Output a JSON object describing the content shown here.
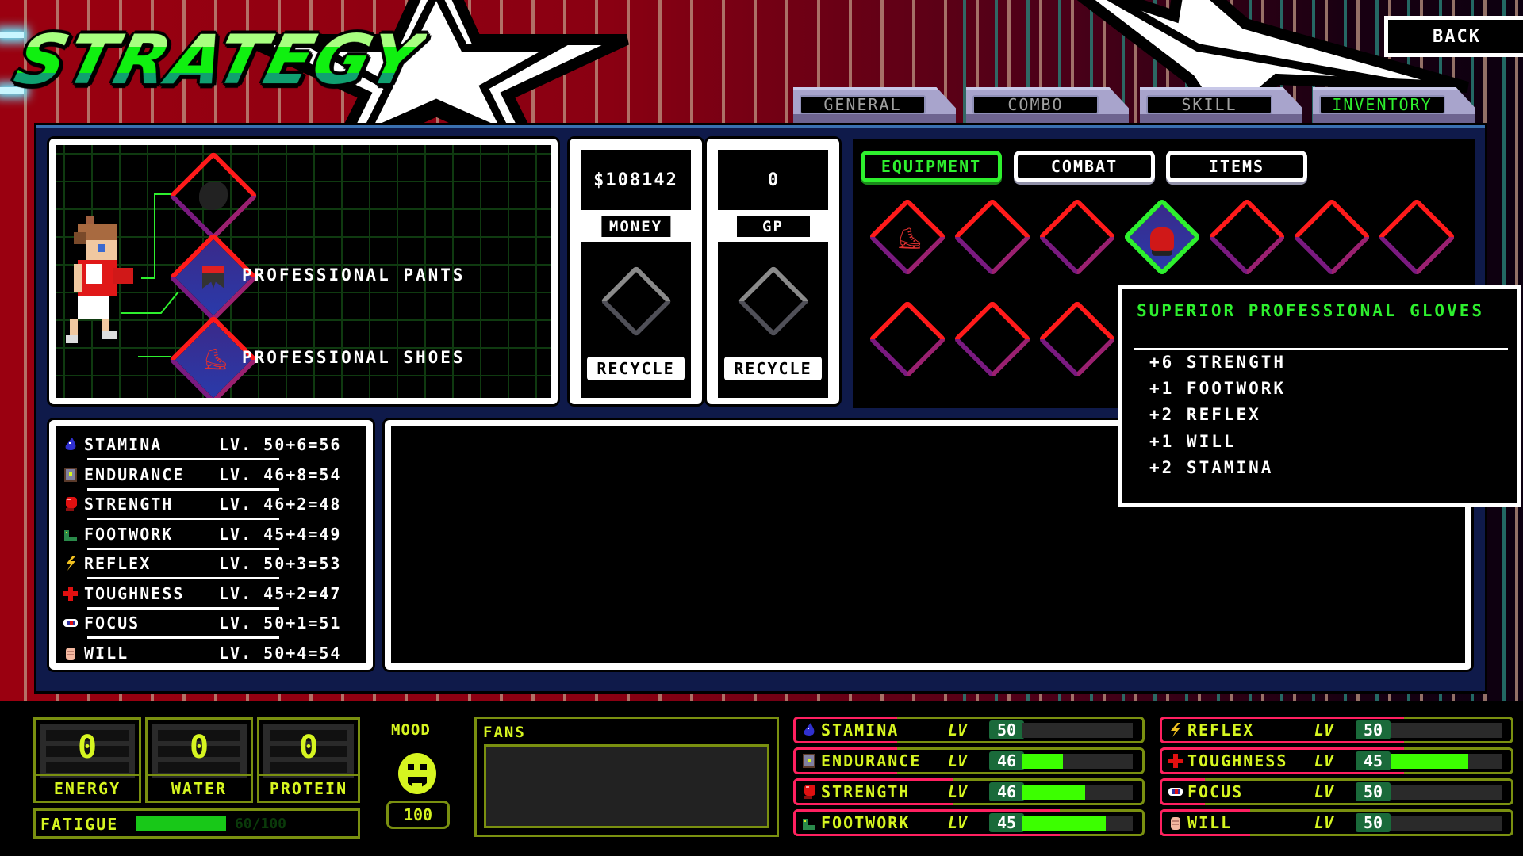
{
  "header": {
    "title": "STRATEGY",
    "back_label": "BACK"
  },
  "tabs": [
    {
      "label": "GENERAL",
      "active": false
    },
    {
      "label": "COMBO",
      "active": false
    },
    {
      "label": "SKILL",
      "active": false
    },
    {
      "label": "INVENTORY",
      "active": true
    }
  ],
  "equipped": {
    "slots": [
      {
        "icon": "shirt-slot-empty-icon",
        "label": ""
      },
      {
        "icon": "pants-icon",
        "label": "PROFESSIONAL PANTS"
      },
      {
        "icon": "shoes-icon",
        "label": "PROFESSIONAL SHOES"
      }
    ]
  },
  "money": {
    "value": "$108142",
    "label": "MONEY",
    "recycle_label": "RECYCLE"
  },
  "gp": {
    "value": "0",
    "label": "GP",
    "recycle_label": "RECYCLE"
  },
  "inventory": {
    "subtabs": [
      {
        "label": "EQUIPMENT",
        "active": true
      },
      {
        "label": "COMBAT",
        "active": false
      },
      {
        "label": "ITEMS",
        "active": false
      }
    ],
    "slots_row1": [
      "shoes-icon",
      "",
      "",
      "gloves-icon",
      "",
      "",
      ""
    ],
    "slots_row2": [
      "",
      "",
      ""
    ],
    "selected_index": 3
  },
  "tooltip": {
    "title": "SUPERIOR PROFESSIONAL GLOVES",
    "bonuses": [
      "+6 STRENGTH",
      "+1 FOOTWORK",
      "+2 REFLEX",
      "+1 WILL",
      "+2 STAMINA"
    ]
  },
  "stats": [
    {
      "name": "STAMINA",
      "icon": "water-drop-icon",
      "level": "LV. 50+6=56"
    },
    {
      "name": "ENDURANCE",
      "icon": "door-icon",
      "level": "LV. 46+8=54"
    },
    {
      "name": "STRENGTH",
      "icon": "boxing-glove-icon",
      "level": "LV. 46+2=48"
    },
    {
      "name": "FOOTWORK",
      "icon": "boot-icon",
      "level": "LV. 45+4=49"
    },
    {
      "name": "REFLEX",
      "icon": "lightning-icon",
      "level": "LV. 50+3=53"
    },
    {
      "name": "TOUGHNESS",
      "icon": "cross-icon",
      "level": "LV. 45+2=47"
    },
    {
      "name": "FOCUS",
      "icon": "pill-icon",
      "level": "LV. 50+1=51"
    },
    {
      "name": "WILL",
      "icon": "fist-icon",
      "level": "LV. 50+4=54"
    }
  ],
  "resources": [
    {
      "name": "ENERGY",
      "value": "0"
    },
    {
      "name": "WATER",
      "value": "0"
    },
    {
      "name": "PROTEIN",
      "value": "0"
    }
  ],
  "fatigue": {
    "label": "FATIGUE",
    "value": "60/100",
    "fraction": 0.6
  },
  "mood": {
    "label": "MOOD",
    "value": "100"
  },
  "fans": {
    "label": "FANS"
  },
  "stat_bars": [
    {
      "name": "STAMINA",
      "lv_label": "LV",
      "level": "50",
      "progress": 0.0,
      "xp_fraction": 0.3
    },
    {
      "name": "ENDURANCE",
      "lv_label": "LV",
      "level": "46",
      "progress": 0.37,
      "xp_fraction": 0.3
    },
    {
      "name": "STRENGTH",
      "lv_label": "LV",
      "level": "46",
      "progress": 0.57,
      "xp_fraction": 0.46
    },
    {
      "name": "FOOTWORK",
      "lv_label": "LV",
      "level": "45",
      "progress": 0.76,
      "xp_fraction": 0.77
    },
    {
      "name": "REFLEX",
      "lv_label": "LV",
      "level": "50",
      "progress": 0.0,
      "xp_fraction": 0.7
    },
    {
      "name": "TOUGHNESS",
      "lv_label": "LV",
      "level": "45",
      "progress": 0.7,
      "xp_fraction": 0.7
    },
    {
      "name": "FOCUS",
      "lv_label": "LV",
      "level": "50",
      "progress": 0.0,
      "xp_fraction": 0.13
    },
    {
      "name": "WILL",
      "lv_label": "LV",
      "level": "50",
      "progress": 0.0,
      "xp_fraction": 0.26
    }
  ]
}
